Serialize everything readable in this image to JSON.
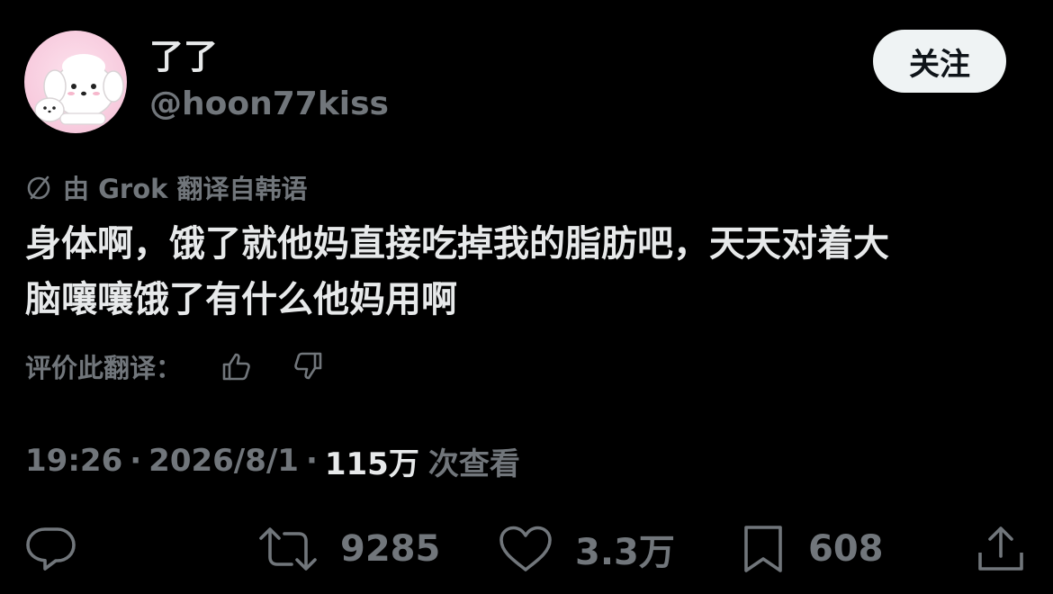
{
  "author": {
    "display_name": "了了",
    "handle": "@hoon77kiss"
  },
  "follow_label": "关注",
  "translation_note": "由 Grok 翻译自韩语",
  "tweet": {
    "lines": [
      "身体啊，饿了就他妈直接吃掉我的脂肪吧，天天对着大",
      "脑嚷嚷饿了有什么他妈用啊"
    ]
  },
  "rate_translation_label": "评价此翻译：",
  "meta": {
    "time": "19:26",
    "date": "2026/8/1",
    "views": "115万",
    "views_label": "次查看",
    "separator": "·"
  },
  "actions": {
    "retweets": "9285",
    "likes": "3.3万",
    "bookmarks": "608"
  },
  "colors": {
    "background": "#000000",
    "primary_text": "#e7e9ea",
    "secondary_text": "#71767b",
    "follow_button_bg": "#eff3f4"
  },
  "icons": {
    "translate": "translate-icon",
    "thumb_up": "thumb-up-icon",
    "thumb_down": "thumb-down-icon",
    "reply": "reply-icon",
    "retweet": "retweet-icon",
    "like": "heart-icon",
    "bookmark": "bookmark-icon",
    "share": "share-icon"
  }
}
